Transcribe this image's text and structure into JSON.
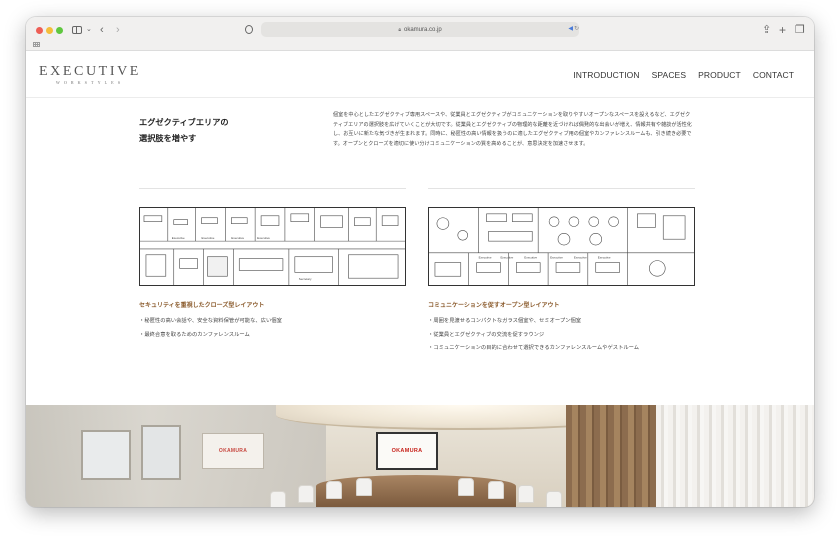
{
  "browser": {
    "url": "okamura.co.jp"
  },
  "site": {
    "logo_main": "EXECUTIVE",
    "logo_sub": "WORKSTYLES",
    "nav": [
      "INTRODUCTION",
      "SPACES",
      "PRODUCT",
      "CONTACT"
    ]
  },
  "section": {
    "heading_line1": "エグゼクティブエリアの",
    "heading_line2": "選択肢を増やす",
    "lead": "個室を中心としたエグゼクティブ専用スペースや、従業員とエグゼクティブがコミュニケーションを取りやすいオープンなスペースを設えるなど、エグゼクティブエリアの選択肢を広げていくことが大切です。従業員とエグゼクティブの物理的な距離を近づければ偶発的な出会いが増え、情報共有や雑談が活性化し、お互いに新たな気づきが生まれます。同時に、秘匿性の高い情報を扱うのに適したエグゼクティブ用の個室やカンファレンスルームも、引き続き必要です。オープンとクローズを適切に使い分けコミュニケーションの質を高めることが、意思決定を加速させます。"
  },
  "layouts": [
    {
      "title": "セキュリティを重視したクローズ型レイアウト",
      "bullets": [
        "秘匿性の高い会話や、安全な資料保管が可能な、広い個室",
        "最終合意を取るためのカンファレンスルーム"
      ],
      "plan_labels": [
        "Executive",
        "Executive",
        "Executive",
        "Executive",
        "Secretary"
      ]
    },
    {
      "title": "コミュニケーションを促すオープン型レイアウト",
      "bullets": [
        "周囲を見渡せるコンパクトなガラス個室や、セミオープン個室",
        "従業員とエグゼクティブの交流を促すラウンジ",
        "コミュニケーションの目的に合わせて選択できるカンファレンスルームやゲストルーム"
      ],
      "plan_labels": [
        "Executive",
        "Executive",
        "Executive",
        "Executive",
        "Executive",
        "Executive"
      ]
    }
  ],
  "photo": {
    "screen_left_logo": "OKAMURA",
    "screen_center_logo": "OKAMURA"
  },
  "colors": {
    "accent_brown": "#8a5a2b",
    "brand_red": "#c7221b"
  }
}
